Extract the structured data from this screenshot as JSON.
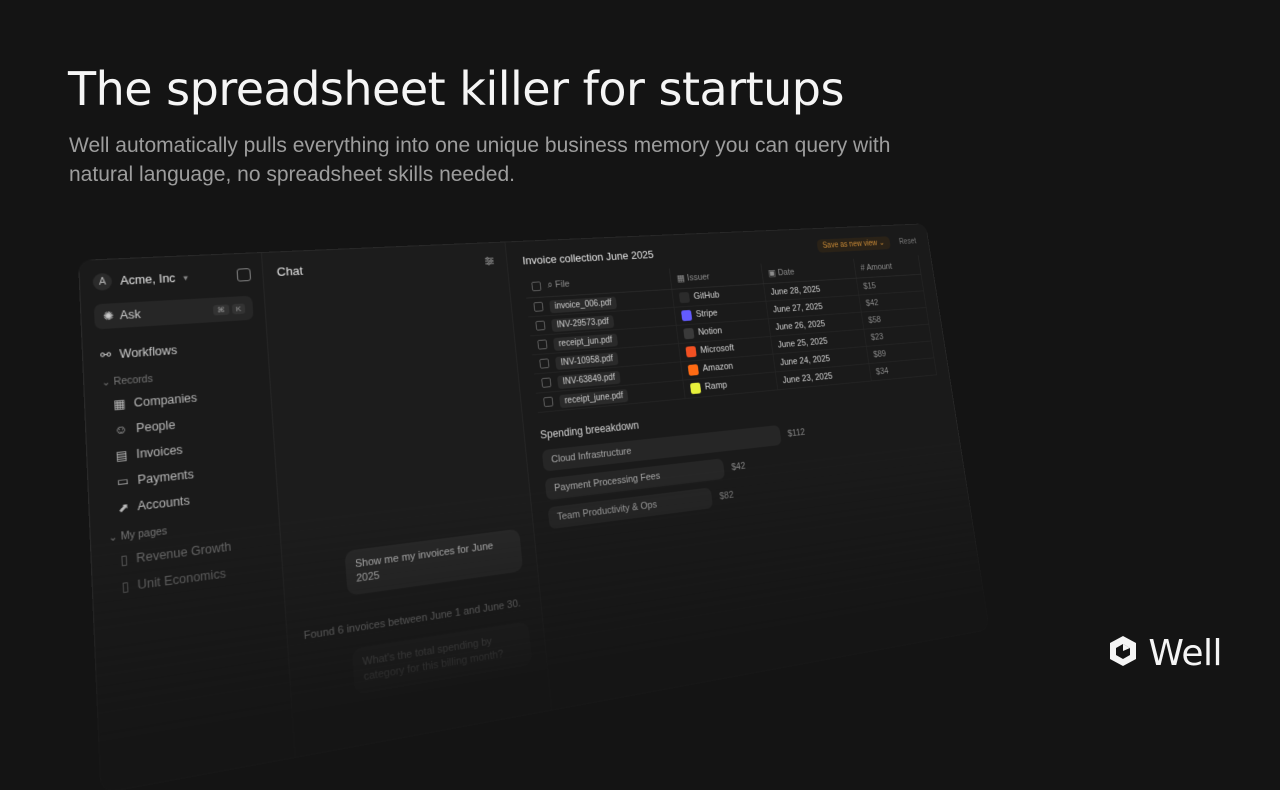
{
  "hero": {
    "title": "The spreadsheet killer for startups",
    "subtitle": "Well automatically pulls everything into one unique business memory you can query with natural language, no spreadsheet skills needed."
  },
  "brand": {
    "name": "Well"
  },
  "sidebar": {
    "workspace_initial": "A",
    "workspace_name": "Acme, Inc",
    "ask_label": "Ask",
    "ask_shortcut": [
      "⌘",
      "K"
    ],
    "workflows_label": "Workflows",
    "records_label": "Records",
    "records": [
      "Companies",
      "People",
      "Invoices",
      "Payments",
      "Accounts"
    ],
    "pages_label": "My pages",
    "pages": [
      "Revenue Growth",
      "Unit Economics"
    ]
  },
  "chat": {
    "title": "Chat",
    "user_message": "Show me my invoices for June 2025",
    "reply": "Found 6 invoices between June 1 and June 30.",
    "followup": "What's the total spending by category for this billing month?"
  },
  "main": {
    "title": "Invoice collection June 2025",
    "save_view": "Save as new view",
    "reset": "Reset",
    "columns": [
      "File",
      "Issuer",
      "Date",
      "Amount"
    ],
    "rows": [
      {
        "file": "invoice_006.pdf",
        "issuer": "GitHub",
        "date": "June 28, 2025",
        "amount": "$15"
      },
      {
        "file": "INV-29573.pdf",
        "issuer": "Stripe",
        "date": "June 27, 2025",
        "amount": "$42"
      },
      {
        "file": "receipt_jun.pdf",
        "issuer": "Notion",
        "date": "June 26, 2025",
        "amount": "$58"
      },
      {
        "file": "INV-10958.pdf",
        "issuer": "Microsoft",
        "date": "June 25, 2025",
        "amount": "$23"
      },
      {
        "file": "INV-63849.pdf",
        "issuer": "Amazon",
        "date": "June 24, 2025",
        "amount": "$89"
      },
      {
        "file": "receipt_june.pdf",
        "issuer": "Ramp",
        "date": "June 23, 2025",
        "amount": "$34"
      }
    ],
    "issuer_colors": {
      "GitHub": "#2b2b2b",
      "Stripe": "#635bff",
      "Notion": "#3a3a3a",
      "Microsoft": "#f25022",
      "Amazon": "#ff6a13",
      "Ramp": "#e7f03b"
    },
    "breakdown": {
      "title": "Spending breeakdown",
      "items": [
        {
          "label": "Cloud Infrastructure",
          "value": "$112"
        },
        {
          "label": "Payment Processing Fees",
          "value": "$42"
        },
        {
          "label": "Team Productivity & Ops",
          "value": "$82"
        }
      ]
    }
  }
}
